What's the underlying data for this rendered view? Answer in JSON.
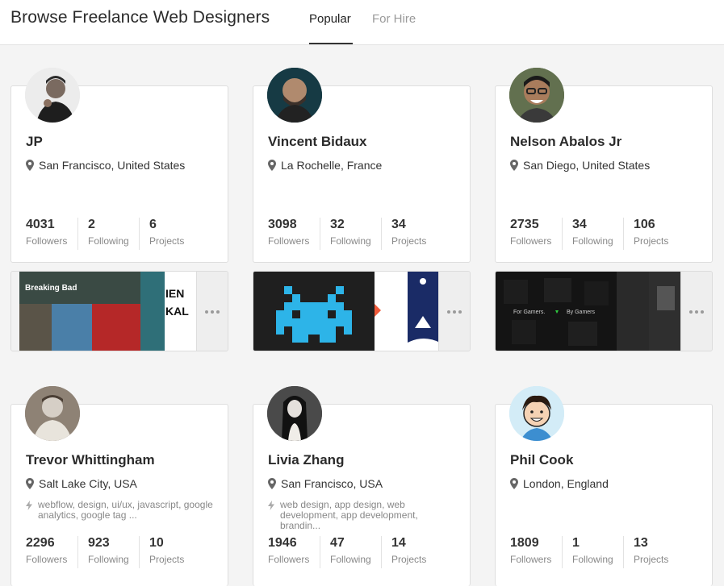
{
  "header": {
    "title": "Browse Freelance Web Designers",
    "tabs": [
      "Popular",
      "For Hire"
    ],
    "active_tab": "Popular"
  },
  "stat_labels": {
    "followers": "Followers",
    "following": "Following",
    "projects": "Projects"
  },
  "designers": [
    {
      "name": "JP",
      "location": "San Francisco, United States",
      "tags": "",
      "followers": "4031",
      "following": "2",
      "projects": "6",
      "thumb_text": [
        "Breaking Bad",
        "IEN",
        "KAL"
      ]
    },
    {
      "name": "Vincent Bidaux",
      "location": "La Rochelle, France",
      "tags": "",
      "followers": "3098",
      "following": "32",
      "projects": "34"
    },
    {
      "name": "Nelson Abalos Jr",
      "location": "San Diego, United States",
      "tags": "",
      "followers": "2735",
      "following": "34",
      "projects": "106",
      "thumb_text": [
        "For Gamers.",
        "By Gamers"
      ]
    },
    {
      "name": "Trevor Whittingham",
      "location": "Salt Lake City, USA",
      "tags": "webflow, design, ui/ux, javascript, google analytics, google tag ...",
      "followers": "2296",
      "following": "923",
      "projects": "10"
    },
    {
      "name": "Livia Zhang",
      "location": "San Francisco, USA",
      "tags": "web design, app design, web development, app development, brandin...",
      "followers": "1946",
      "following": "47",
      "projects": "14"
    },
    {
      "name": "Phil Cook",
      "location": "London, England",
      "tags": "",
      "followers": "1809",
      "following": "1",
      "projects": "13"
    }
  ],
  "colors": {
    "accent": "#333333",
    "muted": "#888888",
    "tab_inactive": "#9a9a9a",
    "background": "#f4f4f4"
  }
}
